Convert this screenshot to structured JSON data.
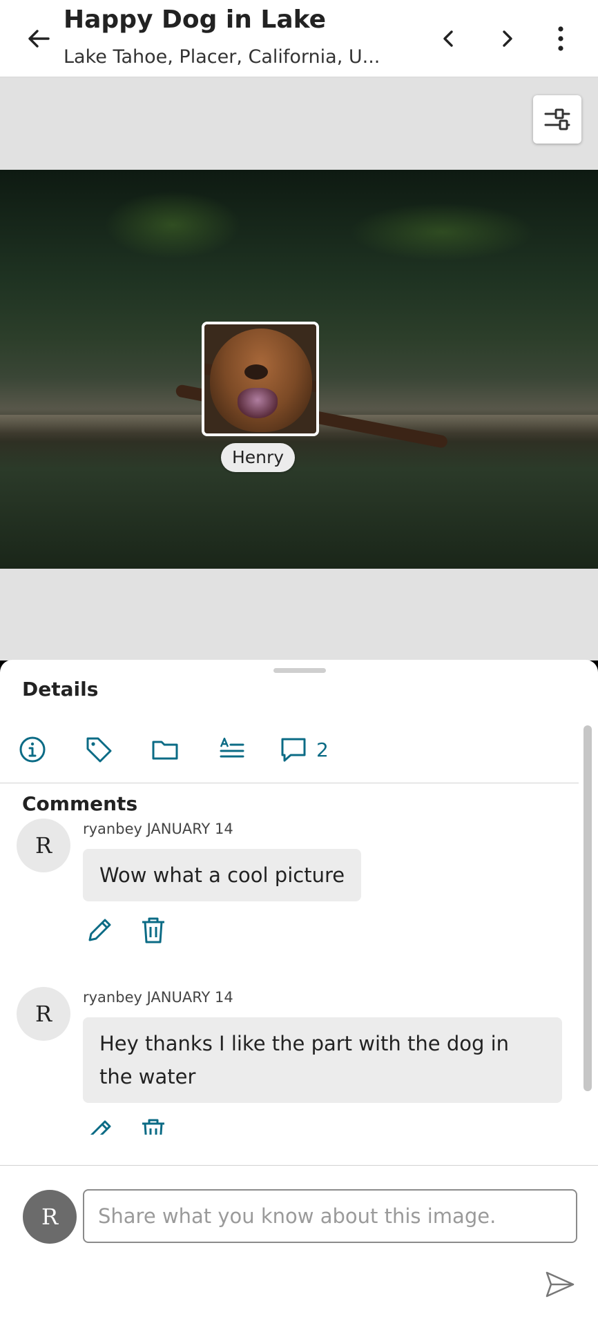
{
  "header": {
    "title": "Happy Dog in Lake",
    "subtitle": "Lake Tahoe, Placer, California, U..."
  },
  "photo": {
    "face_tag": "Henry"
  },
  "details": {
    "title": "Details",
    "comment_count": "2",
    "comments_title": "Comments"
  },
  "comments": [
    {
      "avatar_initial": "R",
      "author": "ryanbey",
      "date": "January 14",
      "text": "Wow what a cool picture"
    },
    {
      "avatar_initial": "R",
      "author": "ryanbey",
      "date": "January 14",
      "text": "Hey thanks I like the part with the dog in the water"
    }
  ],
  "composer": {
    "avatar_initial": "R",
    "placeholder": "Share what you know about this image."
  },
  "colors": {
    "accent": "#0b6b85",
    "header_bg": "#ffffff",
    "viewer_bg": "#e1e1e1",
    "bubble_bg": "#ececec"
  }
}
